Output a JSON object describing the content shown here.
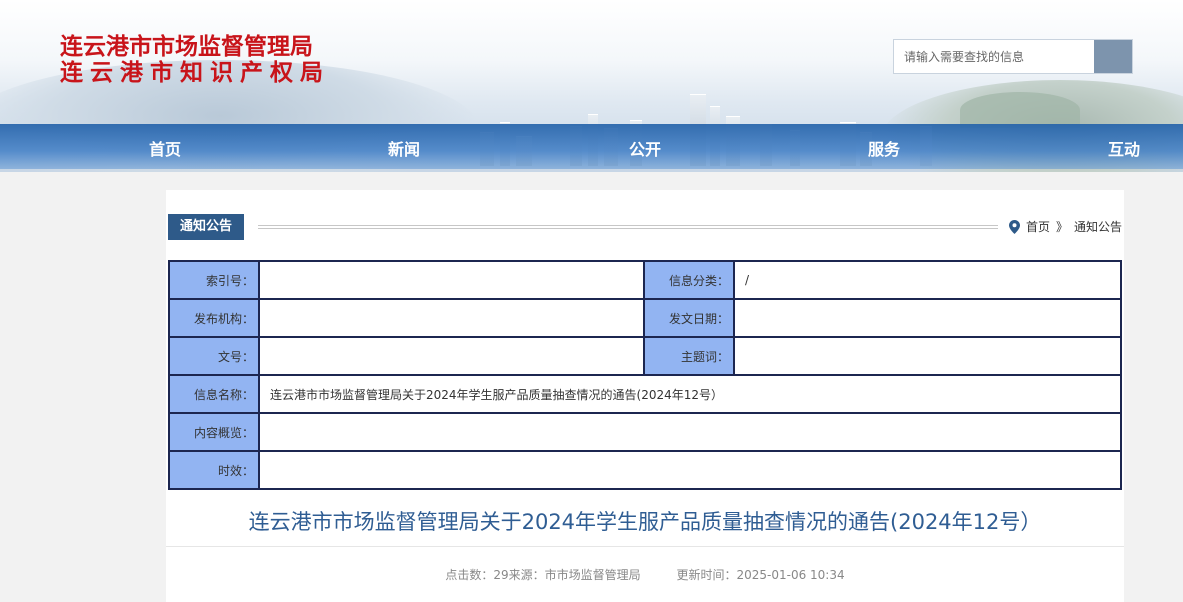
{
  "site": {
    "title_line1": "连云港市市场监督管理局",
    "title_line2": "连云港市知识产权局"
  },
  "search": {
    "placeholder": "请输入需要查找的信息",
    "button_icon": "search-icon"
  },
  "nav": {
    "items": [
      "首页",
      "新闻",
      "公开",
      "服务",
      "互动"
    ]
  },
  "section": {
    "tag": "通知公告",
    "breadcrumb": {
      "home": "首页",
      "separator": "》",
      "current": "通知公告",
      "icon": "location-pin-icon"
    }
  },
  "info_table": {
    "index_label": "索引号：",
    "index_value": "",
    "category_label": "信息分类：",
    "category_value": "/",
    "publisher_label": "发布机构：",
    "publisher_value": "",
    "date_label": "发文日期：",
    "date_value": "",
    "doc_no_label": "文号：",
    "doc_no_value": "",
    "subject_label": "主题词：",
    "subject_value": "",
    "name_label": "信息名称：",
    "name_value": "连云港市市场监督管理局关于2024年学生服产品质量抽查情况的通告(2024年12号）",
    "summary_label": "内容概览：",
    "summary_value": "",
    "validity_label": "时效：",
    "validity_value": ""
  },
  "article": {
    "title": "连云港市市场监督管理局关于2024年学生服产品质量抽查情况的通告(2024年12号）",
    "clicks_source": "点击数：29来源：市市场监督管理局",
    "update_time": "更新时间：2025-01-06 10:34"
  },
  "colors": {
    "logo_red": "#c8141a",
    "nav_blue": "#2563aa",
    "tag_blue": "#2e5a89",
    "label_cell": "#92b4f2",
    "table_border": "#1c2650",
    "title_blue": "#2f5d93"
  }
}
